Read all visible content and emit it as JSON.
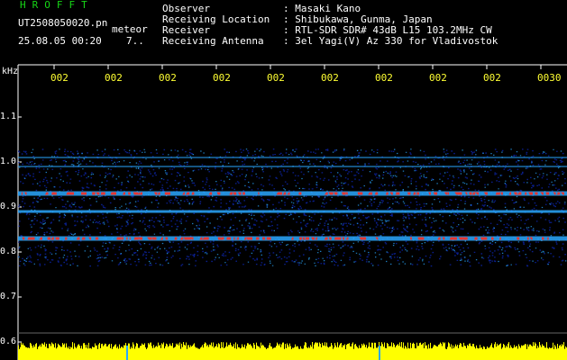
{
  "header": {
    "app_name": "HROFFT",
    "filename": "UT2508050020.pn",
    "mode": "meteor",
    "datetime": "25.08.05 00:20",
    "extra": "7..",
    "fields": [
      {
        "label": "Observer",
        "value": ": Masaki Kano"
      },
      {
        "label": "Receiving Location",
        "value": ": Shibukawa, Gunma, Japan"
      },
      {
        "label": "Receiver",
        "value": ": RTL-SDR SDR# 43dB L15 103.2MHz CW"
      },
      {
        "label": "Receiving Antenna",
        "value": ": 3el Yagi(V) Az 330 for Vladivostok"
      }
    ]
  },
  "plot": {
    "y_unit": "kHz",
    "y_ticks": [
      "1.1",
      "1.0",
      "0.9",
      "0.8",
      "0.7",
      "0.6"
    ],
    "x_ticks": [
      "002",
      "002",
      "002",
      "002",
      "002",
      "002",
      "002",
      "002",
      "002",
      "0030"
    ],
    "colors": {
      "background": "#000000",
      "signal_low": "#0a1e8c",
      "signal_mid": "#2aa8ff",
      "signal_high": "#ff2a1a",
      "level_bar": "#ffff00",
      "axis": "#ffffff"
    }
  },
  "chart_data": {
    "type": "heatmap",
    "title": "",
    "xlabel": "",
    "ylabel": "kHz",
    "ylim": [
      0.6,
      1.15
    ],
    "x_tick_labels": [
      "002",
      "002",
      "002",
      "002",
      "002",
      "002",
      "002",
      "002",
      "002",
      "0030"
    ],
    "y_tick_labels": [
      "1.1",
      "1.0",
      "0.9",
      "0.8",
      "0.7",
      "0.6"
    ],
    "noise_band_khz": [
      0.77,
      1.03
    ],
    "carrier_lines_khz": [
      {
        "freq": 0.93,
        "strength": "high"
      },
      {
        "freq": 0.83,
        "strength": "high"
      },
      {
        "freq": 0.89,
        "strength": "medium"
      },
      {
        "freq": 0.99,
        "strength": "low"
      },
      {
        "freq": 1.01,
        "strength": "low"
      }
    ]
  }
}
